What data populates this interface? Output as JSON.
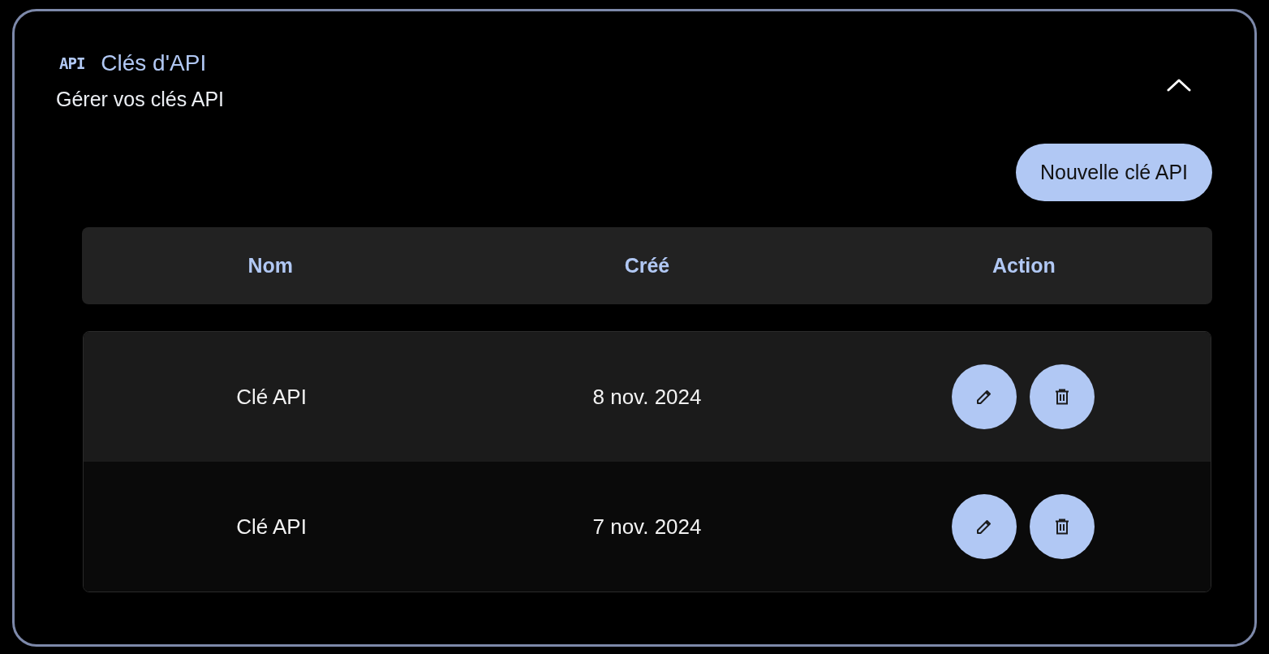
{
  "panel": {
    "badge": "API",
    "title": "Clés d'API",
    "subtitle": "Gérer vos clés API",
    "expanded": true
  },
  "new_button": "Nouvelle clé API",
  "table": {
    "columns": [
      "Nom",
      "Créé",
      "Action"
    ],
    "rows": [
      {
        "name": "Clé API",
        "created": "8 nov. 2024"
      },
      {
        "name": "Clé API",
        "created": "7 nov. 2024"
      }
    ]
  }
}
